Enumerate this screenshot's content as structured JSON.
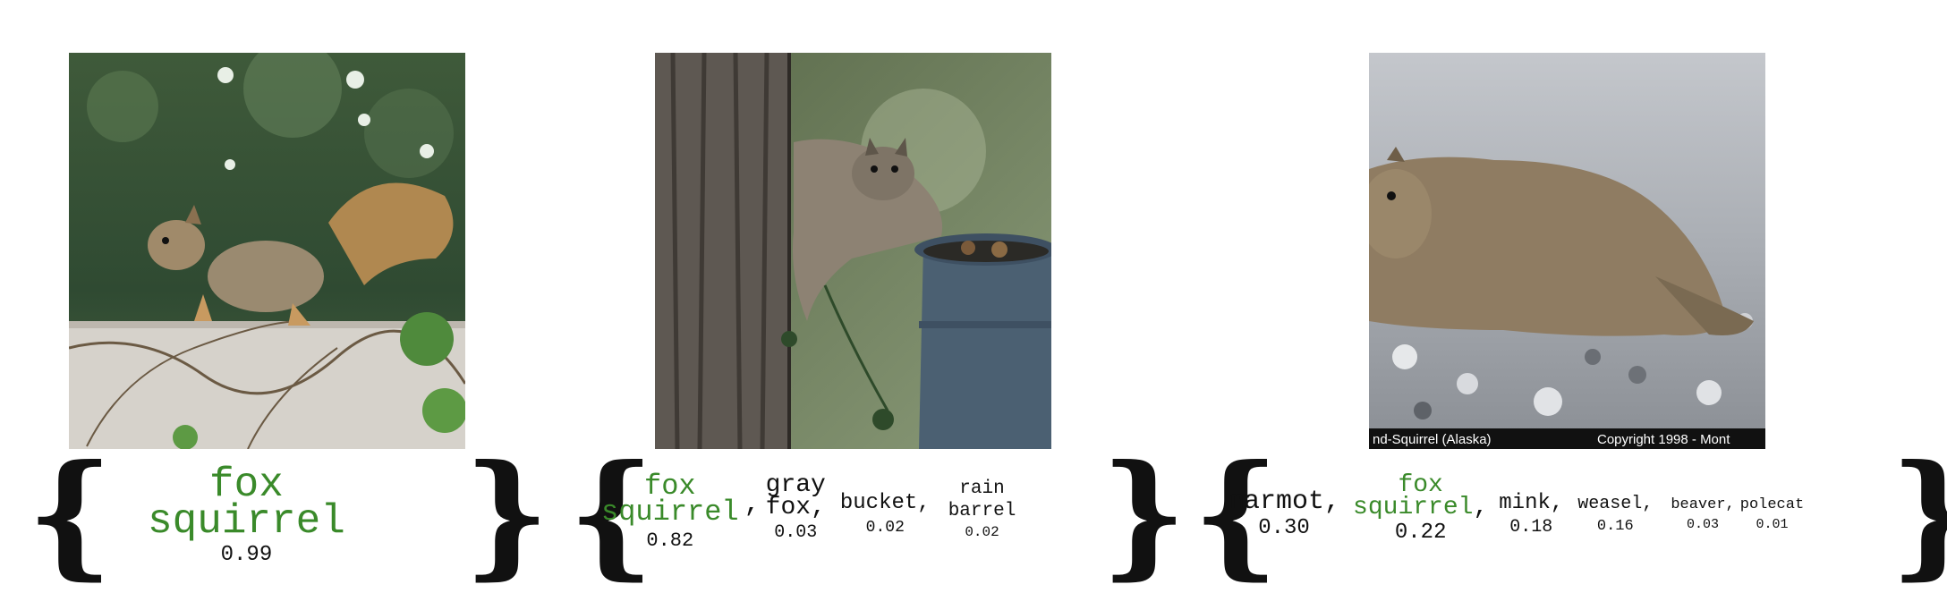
{
  "panels": [
    {
      "predictions": [
        {
          "label_lines": [
            "fox",
            "squirrel"
          ],
          "score": "0.99",
          "correct": true
        }
      ]
    },
    {
      "predictions": [
        {
          "label_lines": [
            "fox",
            "squirrel"
          ],
          "score": "0.82",
          "correct": true
        },
        {
          "label_lines": [
            "gray",
            "fox"
          ],
          "score": "0.03",
          "correct": false
        },
        {
          "label_lines": [
            "bucket"
          ],
          "score": "0.02",
          "correct": false
        },
        {
          "label_lines": [
            "rain",
            "barrel"
          ],
          "score": "0.02",
          "correct": false
        }
      ]
    },
    {
      "caption": "nd-Squirrel (Alaska)",
      "copyright": "Copyright 1998 - Mont",
      "predictions": [
        {
          "label_lines": [
            "marmot"
          ],
          "score": "0.30",
          "correct": false
        },
        {
          "label_lines": [
            "fox",
            "squirrel"
          ],
          "score": "0.22",
          "correct": true
        },
        {
          "label_lines": [
            "mink"
          ],
          "score": "0.18",
          "correct": false
        },
        {
          "label_lines": [
            "weasel"
          ],
          "score": "0.16",
          "correct": false
        },
        {
          "label_lines": [
            "beaver"
          ],
          "score": "0.03",
          "correct": false
        },
        {
          "label_lines": [
            "polecat"
          ],
          "score": "0.01",
          "correct": false
        }
      ]
    }
  ],
  "brace_open": "{",
  "brace_close": "}",
  "separator": ",",
  "colors": {
    "correct": "#3a8a2a",
    "text": "#111111"
  }
}
